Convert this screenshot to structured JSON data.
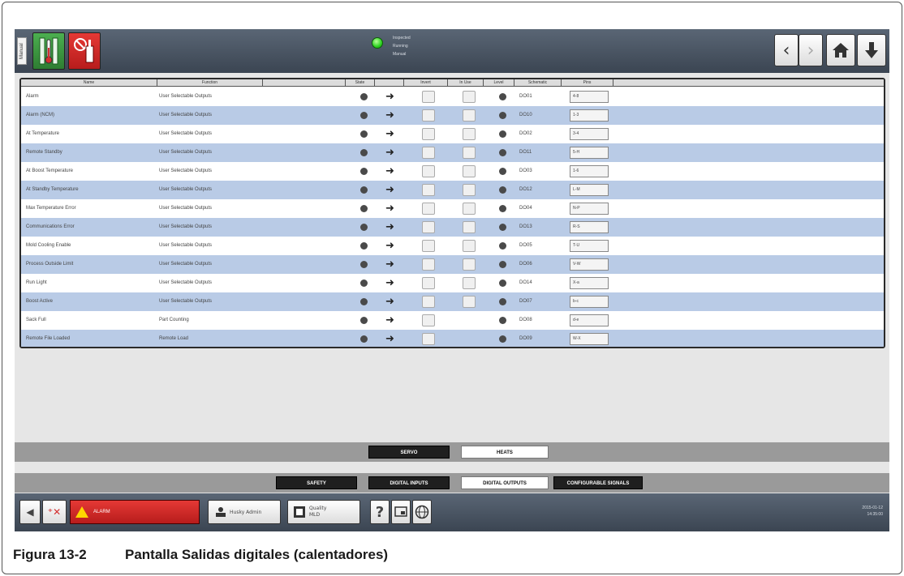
{
  "topbar": {
    "side_tag": "Manual",
    "status_lines": [
      "Inspected",
      "Running",
      "Manual"
    ]
  },
  "table": {
    "headers": [
      "Name",
      "Function",
      "",
      "State",
      "",
      "Invert",
      "In Use",
      "Level",
      "Schematic",
      "Pins"
    ],
    "rows": [
      {
        "name": "Alarm",
        "function": "User Selectable Outputs",
        "schematic": "DO01",
        "pins": "4-8"
      },
      {
        "name": "Alarm (NCM)",
        "function": "User Selectable Outputs",
        "schematic": "DO10",
        "pins": "1-3"
      },
      {
        "name": "At Temperature",
        "function": "User Selectable Outputs",
        "schematic": "DO02",
        "pins": "3-4"
      },
      {
        "name": "Remote Standby",
        "function": "User Selectable Outputs",
        "schematic": "DO11",
        "pins": "5-H"
      },
      {
        "name": "At Boost Temperature",
        "function": "User Selectable Outputs",
        "schematic": "DO03",
        "pins": "1-6"
      },
      {
        "name": "At Standby Temperature",
        "function": "User Selectable Outputs",
        "schematic": "DO12",
        "pins": "L-M"
      },
      {
        "name": "Max Temperature Error",
        "function": "User Selectable Outputs",
        "schematic": "DO04",
        "pins": "N-P"
      },
      {
        "name": "Communications Error",
        "function": "User Selectable Outputs",
        "schematic": "DO13",
        "pins": "R-S"
      },
      {
        "name": "Mold Cooling Enable",
        "function": "User Selectable Outputs",
        "schematic": "DO05",
        "pins": "T-U"
      },
      {
        "name": "Process Outside Limit",
        "function": "User Selectable Outputs",
        "schematic": "DO06",
        "pins": "V-W"
      },
      {
        "name": "Run Light",
        "function": "User Selectable Outputs",
        "schematic": "DO14",
        "pins": "X-a"
      },
      {
        "name": "Boost Active",
        "function": "User Selectable Outputs",
        "schematic": "DO07",
        "pins": "b-c"
      },
      {
        "name": "Sack Full",
        "function": "Part Counting",
        "schematic": "DO08",
        "pins": "d-e"
      },
      {
        "name": "Remote File Loaded",
        "function": "Remote Load",
        "schematic": "DO09",
        "pins": "W-X"
      }
    ]
  },
  "tabs_row1": [
    "SERVO",
    "HEATS"
  ],
  "tabs_row2": [
    "SAFETY",
    "DIGITAL INPUTS",
    "DIGITAL OUTPUTS",
    "CONFIGURABLE SIGNALS"
  ],
  "bottombar": {
    "alarm_text": "ALARM",
    "user_label": "Husky Admin",
    "mold_label": "Quality",
    "mold_sub": "MLD",
    "help_label": "?",
    "clock_date": "2015-01-12",
    "clock_time": "14:35:00"
  },
  "caption": {
    "number": "Figura 13-2",
    "title": "Pantalla Salidas digitales (calentadores)"
  }
}
